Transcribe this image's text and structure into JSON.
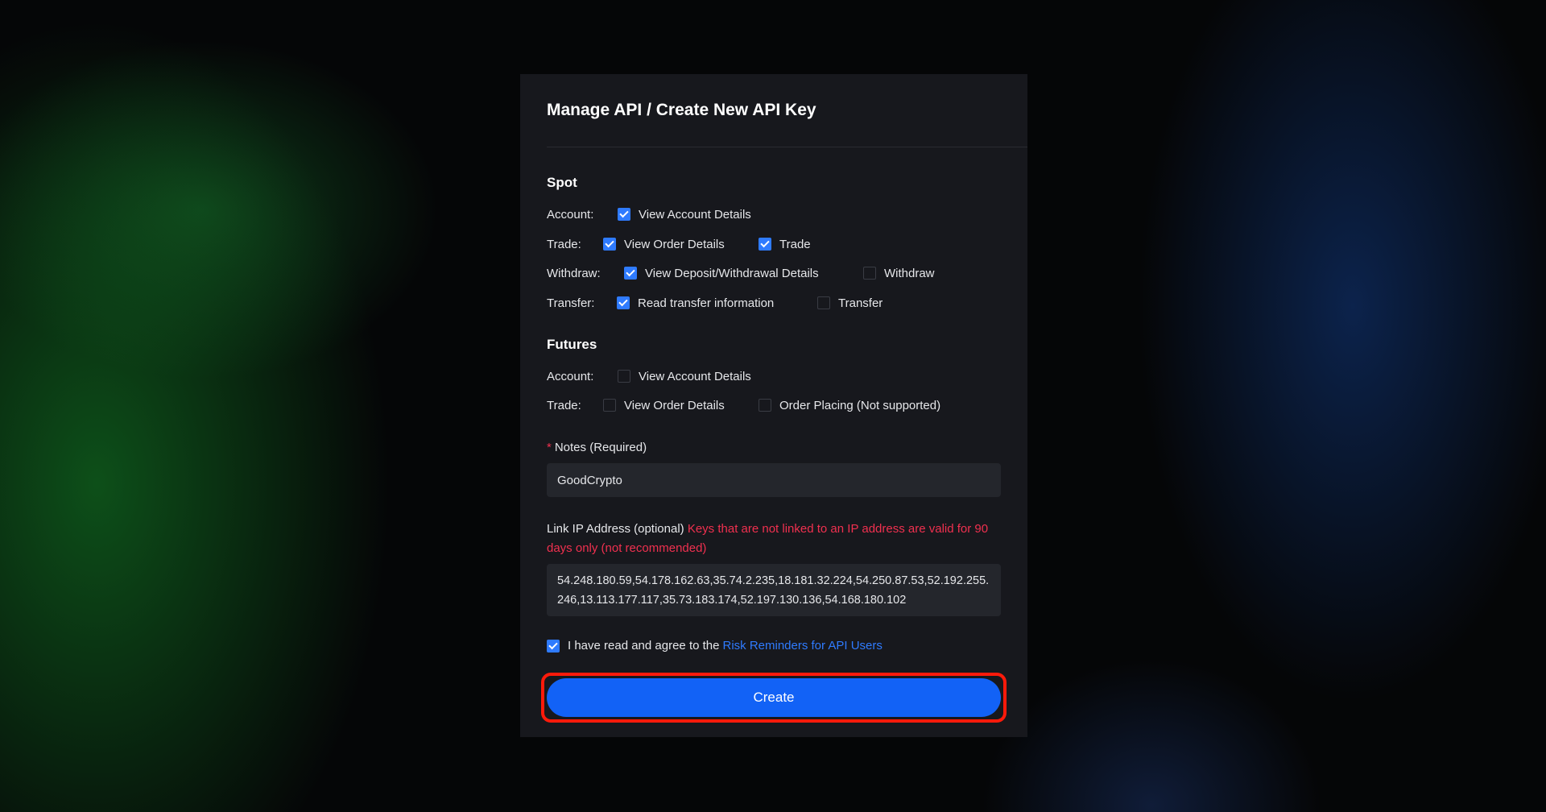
{
  "title": "Manage API / Create New API Key",
  "spot": {
    "heading": "Spot",
    "account": {
      "label": "Account:",
      "options": [
        {
          "text": "View Account Details",
          "checked": true
        }
      ]
    },
    "trade": {
      "label": "Trade:",
      "options": [
        {
          "text": "View Order Details",
          "checked": true
        },
        {
          "text": "Trade",
          "checked": true
        }
      ]
    },
    "withdraw": {
      "label": "Withdraw:",
      "options": [
        {
          "text": "View Deposit/Withdrawal Details",
          "checked": true
        },
        {
          "text": "Withdraw",
          "checked": false
        }
      ]
    },
    "transfer": {
      "label": "Transfer:",
      "options": [
        {
          "text": "Read transfer information",
          "checked": true
        },
        {
          "text": "Transfer",
          "checked": false
        }
      ]
    }
  },
  "futures": {
    "heading": "Futures",
    "account": {
      "label": "Account:",
      "options": [
        {
          "text": "View Account Details",
          "checked": false
        }
      ]
    },
    "trade": {
      "label": "Trade:",
      "options": [
        {
          "text": "View Order Details",
          "checked": false
        },
        {
          "text": "Order Placing (Not supported)",
          "checked": false
        }
      ]
    }
  },
  "notes": {
    "star": "*",
    "label": "Notes (Required)",
    "value": "GoodCrypto"
  },
  "ip": {
    "label": "Link IP Address (optional)",
    "warning": "Keys that are not linked to an IP address are valid for 90 days only (not recommended)",
    "value": "54.248.180.59,54.178.162.63,35.74.2.235,18.181.32.224,54.250.87.53,52.192.255.246,13.113.177.117,35.73.183.174,52.197.130.136,54.168.180.102"
  },
  "agree": {
    "checked": true,
    "text": "I have read and agree to the",
    "link": "Risk Reminders for API Users"
  },
  "create_label": "Create",
  "colors": {
    "accent": "#1262f6",
    "checkbox": "#2f7bff",
    "warning": "#f0304f",
    "highlight": "#ff1a0a",
    "panel": "#17181d"
  }
}
